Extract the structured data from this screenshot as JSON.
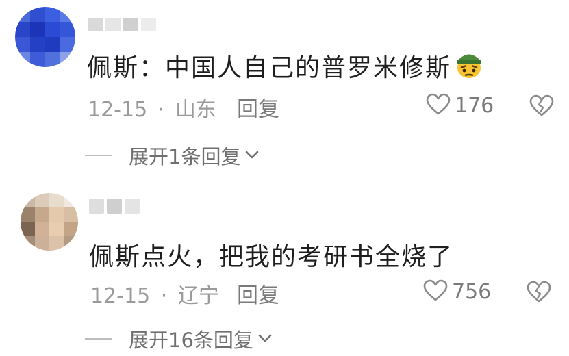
{
  "comments": [
    {
      "content": "佩斯：中国人自己的普罗米修斯",
      "emoji": "pensive-soldier-emoji",
      "date": "12-15",
      "location": "山东",
      "reply_label": "回复",
      "likes": "176",
      "expand_label": "展开1条回复"
    },
    {
      "content": "佩斯点火，把我的考研书全烧了",
      "date": "12-15",
      "location": "辽宁",
      "reply_label": "回复",
      "likes": "756",
      "expand_label": "展开16条回复"
    }
  ],
  "separator": "·",
  "icons": {
    "like": "heart-outline-icon",
    "dislike": "broken-heart-icon",
    "expand": "chevron-down-icon"
  },
  "colors": {
    "text": "#1e1e1e",
    "meta": "#9a9a9a",
    "action": "#7a7a7a"
  }
}
